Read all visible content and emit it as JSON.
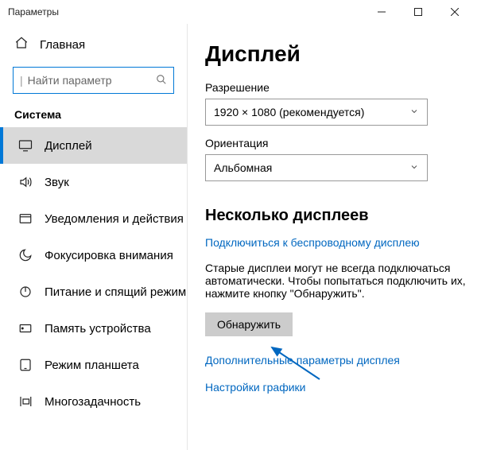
{
  "window": {
    "title": "Параметры"
  },
  "sidebar": {
    "home": "Главная",
    "search_placeholder": "Найти параметр",
    "group": "Система",
    "items": [
      {
        "label": "Дисплей"
      },
      {
        "label": "Звук"
      },
      {
        "label": "Уведомления и действия"
      },
      {
        "label": "Фокусировка внимания"
      },
      {
        "label": "Питание и спящий режим"
      },
      {
        "label": "Память устройства"
      },
      {
        "label": "Режим планшета"
      },
      {
        "label": "Многозадачность"
      }
    ]
  },
  "content": {
    "title": "Дисплей",
    "resolution_label": "Разрешение",
    "resolution_value": "1920 × 1080 (рекомендуется)",
    "orientation_label": "Ориентация",
    "orientation_value": "Альбомная",
    "multi_header": "Несколько дисплеев",
    "wireless_link": "Подключиться к беспроводному дисплею",
    "note": "Старые дисплеи могут не всегда подключаться автоматически. Чтобы попытаться подключить их, нажмите кнопку \"Обнаружить\".",
    "detect_button": "Обнаружить",
    "adv_link": "Дополнительные параметры дисплея",
    "gfx_link": "Настройки графики"
  }
}
